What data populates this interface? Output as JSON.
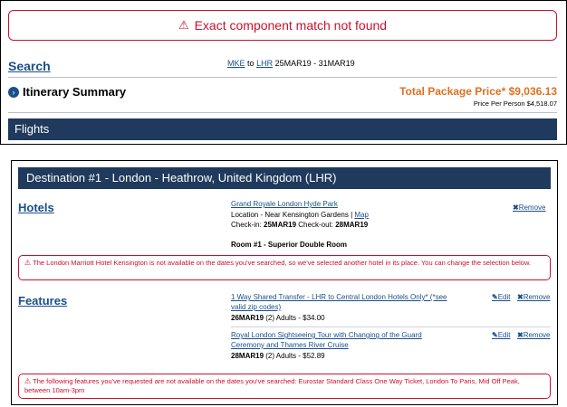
{
  "alert_top": {
    "icon": "warning-icon",
    "text": "Exact component match not found"
  },
  "search": {
    "label": "Search",
    "origin": "MKE",
    "to_word": "to",
    "destination": "LHR",
    "dates": "25MAR19 - 31MAR19"
  },
  "itinerary": {
    "title": "Itinerary Summary",
    "total_label": "Total Package Price* $9,036.13",
    "per_person": "Price Per Person $4,518.07"
  },
  "flights": {
    "title": "Flights"
  },
  "destination": {
    "title": "Destination #1 - London - Heathrow, United Kingdom (LHR)"
  },
  "hotels": {
    "label": "Hotels",
    "name": "Grand Royale London Hyde Park",
    "location_prefix": "Location - Near Kensington Gardens |",
    "map_link": "Map",
    "checkin_label": "Check-in:",
    "checkin": "25MAR19",
    "checkout_label": "Check-out:",
    "checkout": "28MAR19",
    "room": "Room #1 - Superior Double Room",
    "remove": "Remove",
    "alert": "The London Marriott Hotel Kensington is not available on the dates you've searched, so we've selected another hotel in its place. You can change the selection below."
  },
  "features": {
    "label": "Features",
    "items": [
      {
        "title_line1": "1 Way Shared Transfer - LHR to Central London Hotels Only* (*see",
        "title_line2": "valid zip codes)",
        "date": "26MAR19",
        "detail": "(2) Adults - $34.00",
        "edit": "Edit",
        "remove": "Remove"
      },
      {
        "title_line1": "Royal London Sightseeing Tour with Changing of the Guard",
        "title_line2": "Ceremony and Thames River Cruise",
        "date": "28MAR19",
        "detail": "(2) Adults - $52.89",
        "edit": "Edit",
        "remove": "Remove"
      }
    ],
    "alert": "The following features you've requested are not available on the dates you've searched: Eurostar Standard Class One Way Ticket, London To Paris, Mid Off Peak, between 10am-3pm"
  },
  "colors": {
    "accent_red": "#c8102e",
    "link_blue": "#1a4f8b",
    "header_navy": "#1f3a5c",
    "price_orange": "#e07020"
  }
}
